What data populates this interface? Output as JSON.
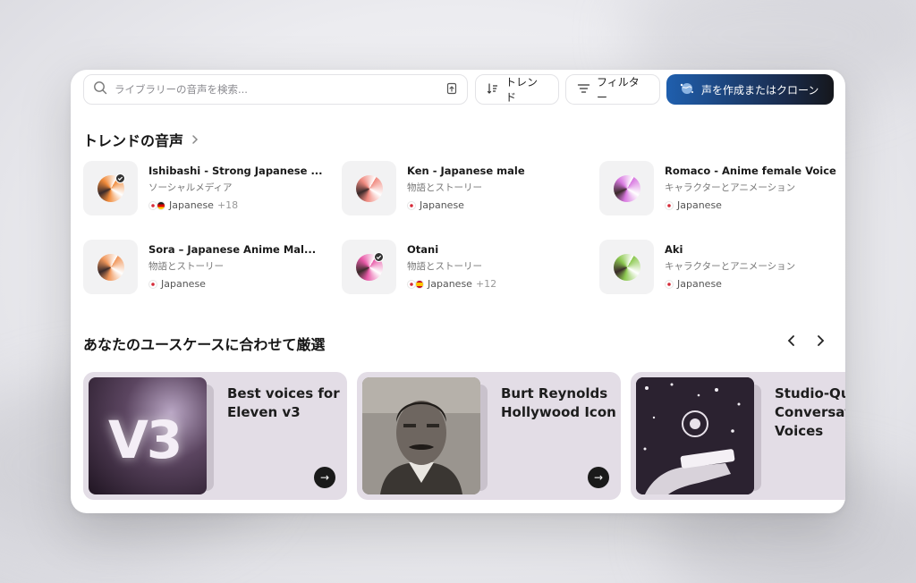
{
  "search": {
    "placeholder": "ライブラリーの音声を検索..."
  },
  "toolbar": {
    "trend_label": "トレンド",
    "filter_label": "フィルター",
    "create_label": "声を作成またはクローン"
  },
  "trending": {
    "title": "トレンドの音声",
    "voices": [
      {
        "name": "Ishibashi - Strong Japanese ...",
        "category": "ソーシャルメディア",
        "language": "Japanese",
        "extra": "+18",
        "verified": true,
        "orb": "#f08a3a"
      },
      {
        "name": "Ken - Japanese male",
        "category": "物語とストーリー",
        "language": "Japanese",
        "extra": "",
        "verified": false,
        "orb": "#f08a80"
      },
      {
        "name": "Romaco - Anime female Voice",
        "category": "キャラクターとアニメーション",
        "language": "Japanese",
        "extra": "",
        "verified": false,
        "orb": "#d878e0"
      },
      {
        "name": "Sora – Japanese Anime Mal...",
        "category": "物語とストーリー",
        "language": "Japanese",
        "extra": "",
        "verified": false,
        "orb": "#f0965a"
      },
      {
        "name": "Otani",
        "category": "物語とストーリー",
        "language": "Japanese",
        "extra": "+12",
        "verified": true,
        "orb": "#e85aa8"
      },
      {
        "name": "Aki",
        "category": "キャラクターとアニメーション",
        "language": "Japanese",
        "extra": "",
        "verified": false,
        "orb": "#8cc850"
      }
    ]
  },
  "usecases": {
    "title": "あなたのユースケースに合わせて厳選",
    "cards": [
      {
        "title": "Best voices for\nEleven v3",
        "image_text": "V3"
      },
      {
        "title": "Burt Reynolds\nHollywood Icon"
      },
      {
        "title": "Studio-Qu\nConversat\nVoices"
      }
    ]
  },
  "colors": {
    "accent": "#1f5fae",
    "card_bg": "#e3dde6"
  }
}
